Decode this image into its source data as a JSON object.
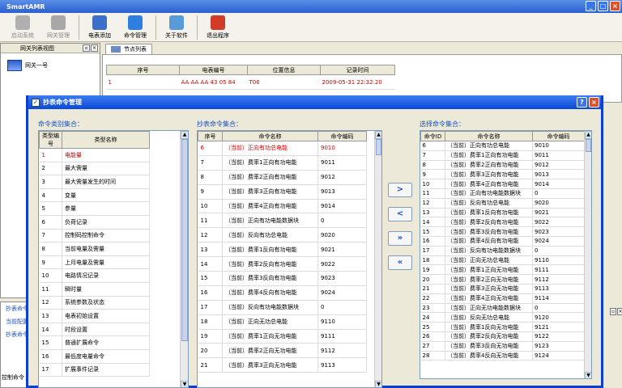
{
  "window": {
    "title": "SmartAMR",
    "min": "_",
    "max": "□",
    "close": "×"
  },
  "toolbar": [
    {
      "label": "启动系统",
      "disabled": true,
      "icon": "play-icon",
      "color": "#b0b0b0"
    },
    {
      "label": "网关管理",
      "disabled": true,
      "icon": "gateway-icon",
      "color": "#a8a8a8"
    },
    {
      "label": "电表添加",
      "disabled": false,
      "icon": "meter-add-icon",
      "color": "#3d6ec8"
    },
    {
      "label": "命令管理",
      "disabled": false,
      "icon": "command-icon",
      "color": "#2f7fe0"
    },
    {
      "label": "关于软件",
      "disabled": false,
      "icon": "about-icon",
      "color": "#5a9ad8"
    },
    {
      "label": "退出程序",
      "disabled": false,
      "icon": "exit-icon",
      "color": "#d23a2a"
    }
  ],
  "left_panel": {
    "title": "网关列表视图",
    "gateway": "网关一号",
    "bottom_items": [
      "抄表命令",
      "当前配置",
      "抄表命令"
    ],
    "bottom_tab": "控制命令"
  },
  "node_tab": {
    "label": "节点列表"
  },
  "node_table": {
    "headers": [
      "序号",
      "电表编号",
      "位置信息",
      "记录时间"
    ],
    "rows": [
      [
        "1",
        "AA AA AA 43 05 84",
        "T06",
        "2009-05-31 22:32:20"
      ]
    ]
  },
  "dialog": {
    "title": "抄表命令管理",
    "help": "?",
    "close": "×",
    "category_section": "命令类别集合：",
    "category_headers": [
      "类型编号",
      "类型名称"
    ],
    "categories": [
      [
        "1",
        "电能量"
      ],
      [
        "2",
        "最大需量"
      ],
      [
        "3",
        "最大需量发生的时间"
      ],
      [
        "4",
        "变量"
      ],
      [
        "5",
        "参量"
      ],
      [
        "6",
        "负荷记录"
      ],
      [
        "7",
        "控制码控制命令"
      ],
      [
        "8",
        "当前电量及需量"
      ],
      [
        "9",
        "上月电量及需量"
      ],
      [
        "10",
        "电路情况记录"
      ],
      [
        "11",
        "瞬时量"
      ],
      [
        "12",
        "系统参数及状态"
      ],
      [
        "13",
        "电表初始设置"
      ],
      [
        "14",
        "时段设置"
      ],
      [
        "15",
        "普通扩展命令"
      ],
      [
        "16",
        "最低度电量命令"
      ],
      [
        "17",
        "扩展事件记录"
      ]
    ],
    "command_section": "抄表命令集合：",
    "command_headers": [
      "序号",
      "命令名称",
      "命令编码"
    ],
    "commands": [
      [
        "6",
        "（当前）正向有功总电能",
        "9010"
      ],
      [
        "7",
        "（当前）费率1正向有功电能",
        "9011"
      ],
      [
        "8",
        "（当前）费率2正向有功电能",
        "9012"
      ],
      [
        "9",
        "（当前）费率3正向有功电能",
        "9013"
      ],
      [
        "10",
        "（当前）费率4正向有功电能",
        "9014"
      ],
      [
        "11",
        "（当前）正向有功电能数据块",
        "0"
      ],
      [
        "12",
        "（当前）反向有功总电能",
        "9020"
      ],
      [
        "13",
        "（当前）费率1反向有功电能",
        "9021"
      ],
      [
        "14",
        "（当前）费率2反向有功电能",
        "9022"
      ],
      [
        "15",
        "（当前）费率3反向有功电能",
        "9023"
      ],
      [
        "16",
        "（当前）费率4反向有功电能",
        "9024"
      ],
      [
        "17",
        "（当前）反向有功电能数据块",
        "0"
      ],
      [
        "18",
        "（当前）正向无功总电能",
        "9110"
      ],
      [
        "19",
        "（当前）费率1正向无功电能",
        "9111"
      ],
      [
        "20",
        "（当前）费率2正向无功电能",
        "9112"
      ],
      [
        "21",
        "（当前）费率3正向无功电能",
        "9113"
      ]
    ],
    "move_buttons": [
      ">",
      "<",
      "»",
      "«"
    ],
    "selected_section": "选择命令集合：",
    "selected_headers": [
      "命令ID",
      "命令名称",
      "命令编码"
    ],
    "selected": [
      [
        "6",
        "（当前）正向有功总电能",
        "9010"
      ],
      [
        "7",
        "（当前）费率1正向有功电能",
        "9011"
      ],
      [
        "8",
        "（当前）费率2正向有功电能",
        "9012"
      ],
      [
        "9",
        "（当前）费率3正向有功电能",
        "9013"
      ],
      [
        "10",
        "（当前）费率4正向有功电能",
        "9014"
      ],
      [
        "11",
        "（当前）正向有功电能数据块",
        "0"
      ],
      [
        "12",
        "（当前）反向有功总电能",
        "9020"
      ],
      [
        "13",
        "（当前）费率1反向有功电能",
        "9021"
      ],
      [
        "14",
        "（当前）费率2反向有功电能",
        "9022"
      ],
      [
        "15",
        "（当前）费率3反向有功电能",
        "9023"
      ],
      [
        "16",
        "（当前）费率4反向有功电能",
        "9024"
      ],
      [
        "17",
        "（当前）反向有功电能数据块",
        "0"
      ],
      [
        "18",
        "（当前）正向无功总电能",
        "9110"
      ],
      [
        "19",
        "（当前）费率1正向无功电能",
        "9111"
      ],
      [
        "20",
        "（当前）费率2正向无功电能",
        "9112"
      ],
      [
        "21",
        "（当前）费率3正向无功电能",
        "9113"
      ],
      [
        "22",
        "（当前）费率4正向无功电能",
        "9114"
      ],
      [
        "23",
        "（当前）正向无功电能数据块",
        "0"
      ],
      [
        "24",
        "（当前）反向无功总电能",
        "9120"
      ],
      [
        "25",
        "（当前）费率1反向无功电能",
        "9121"
      ],
      [
        "26",
        "（当前）费率2反向无功电能",
        "9122"
      ],
      [
        "27",
        "（当前）费率3反向无功电能",
        "9123"
      ],
      [
        "28",
        "（当前）费率4反向无功电能",
        "9124"
      ]
    ]
  }
}
